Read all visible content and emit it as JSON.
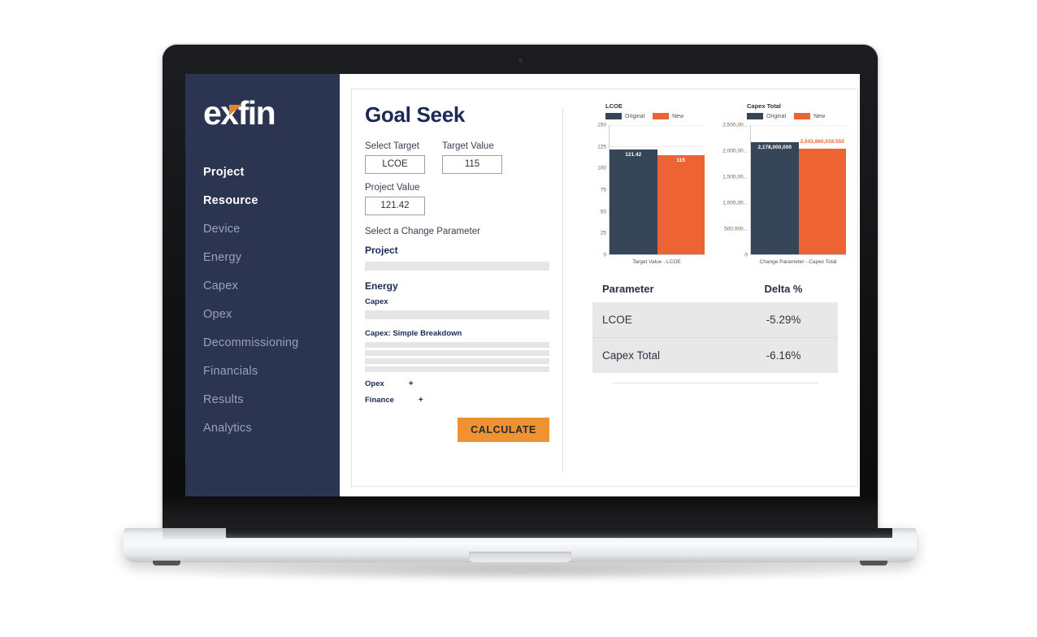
{
  "sidebar": {
    "logo": "exfin",
    "items": [
      {
        "label": "Project",
        "active": true
      },
      {
        "label": "Resource",
        "active": true
      },
      {
        "label": "Device",
        "active": false
      },
      {
        "label": "Energy",
        "active": false
      },
      {
        "label": "Capex",
        "active": false
      },
      {
        "label": "Opex",
        "active": false
      },
      {
        "label": "Decommissioning",
        "active": false
      },
      {
        "label": "Financials",
        "active": false
      },
      {
        "label": "Results",
        "active": false
      },
      {
        "label": "Analytics",
        "active": false
      }
    ]
  },
  "main": {
    "title": "Goal Seek",
    "select_target_label": "Select Target",
    "select_target_value": "LCOE",
    "target_value_label": "Target Value",
    "target_value": "115",
    "project_value_label": "Project Value",
    "project_value": "121.42",
    "change_parameter_label": "Select a Change Parameter",
    "group_project": "Project",
    "group_energy": "Energy",
    "sub_capex": "Capex",
    "sub_capex_breakdown": "Capex: Simple Breakdown",
    "collapsed": [
      {
        "label": "Opex",
        "toggle": "+"
      },
      {
        "label": "Finance",
        "toggle": "+"
      }
    ],
    "calculate_label": "CALCULATE"
  },
  "results": {
    "header_parameter": "Parameter",
    "header_delta": "Delta %",
    "rows": [
      {
        "parameter": "LCOE",
        "delta": "-5.29%"
      },
      {
        "parameter": "Capex Total",
        "delta": "-6.16%"
      }
    ]
  },
  "colors": {
    "sidebar_navy": "#2b3450",
    "bar_original": "#374559",
    "bar_new": "#ee6333",
    "accent_orange": "#ee9234",
    "title_navy": "#1b2a55"
  },
  "chart_data": [
    {
      "type": "bar",
      "title": "LCOE",
      "xlabel": "Target Value - LCOE",
      "ylabel": "",
      "ylim": [
        0,
        150
      ],
      "yticks": [
        "0",
        "25",
        "50",
        "75",
        "100",
        "125",
        "150"
      ],
      "categories": [
        "Target Value - LCOE"
      ],
      "legend": [
        "Original",
        "New"
      ],
      "legend_position": "top-left",
      "grid": true,
      "series": [
        {
          "name": "Original",
          "values": [
            121.42
          ],
          "label": "121.42",
          "color": "#374559"
        },
        {
          "name": "New",
          "values": [
            115
          ],
          "label": "115",
          "color": "#ee6333"
        }
      ]
    },
    {
      "type": "bar",
      "title": "Capex Total",
      "xlabel": "Change Parameter - Capex Total",
      "ylabel": "",
      "ylim": [
        0,
        2500000000
      ],
      "yticks": [
        "0",
        "500,000...",
        "1,000,00...",
        "1,500,00...",
        "2,000,00...",
        "2,500,00..."
      ],
      "categories": [
        "Change Parameter - Capex Total"
      ],
      "legend": [
        "Original",
        "New"
      ],
      "legend_position": "top-left",
      "grid": true,
      "series": [
        {
          "name": "Original",
          "values": [
            2178000000
          ],
          "label": "2,178,000,000",
          "color": "#374559"
        },
        {
          "name": "New",
          "values": [
            2043860018.555
          ],
          "label": "2,043,860,018.555",
          "color": "#ee6333"
        }
      ]
    }
  ]
}
